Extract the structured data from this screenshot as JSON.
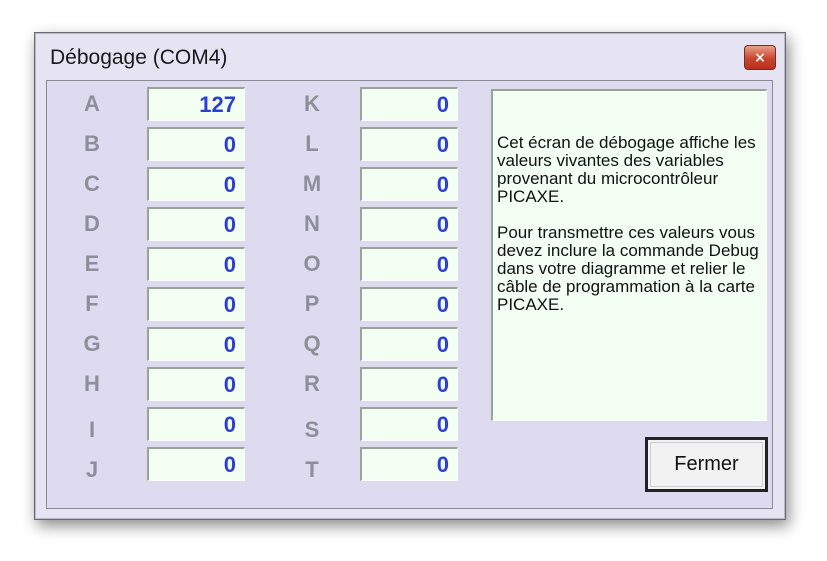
{
  "window": {
    "title": "Débogage (COM4)",
    "close_label": "×"
  },
  "variables": {
    "left": [
      {
        "name": "A",
        "value": "127"
      },
      {
        "name": "B",
        "value": "0"
      },
      {
        "name": "C",
        "value": "0"
      },
      {
        "name": "D",
        "value": "0"
      },
      {
        "name": "E",
        "value": "0"
      },
      {
        "name": "F",
        "value": "0"
      },
      {
        "name": "G",
        "value": "0"
      },
      {
        "name": "H",
        "value": "0"
      },
      {
        "name": "I",
        "value": "0"
      },
      {
        "name": "J",
        "value": "0"
      }
    ],
    "right": [
      {
        "name": "K",
        "value": "0"
      },
      {
        "name": "L",
        "value": "0"
      },
      {
        "name": "M",
        "value": "0"
      },
      {
        "name": "N",
        "value": "0"
      },
      {
        "name": "O",
        "value": "0"
      },
      {
        "name": "P",
        "value": "0"
      },
      {
        "name": "Q",
        "value": "0"
      },
      {
        "name": "R",
        "value": "0"
      },
      {
        "name": "S",
        "value": "0"
      },
      {
        "name": "T",
        "value": "0"
      }
    ]
  },
  "info": {
    "paragraph1": "Cet écran de débogage affiche les valeurs vivantes des variables provenant du microcontrôleur PICAXE.",
    "paragraph2": "Pour transmettre ces valeurs vous devez inclure la commande Debug dans votre diagramme et relier le câble de programmation à la carte PICAXE."
  },
  "buttons": {
    "close_label": "Fermer"
  },
  "colors": {
    "value_text": "#2b3fd6",
    "label_text": "#8e8e98",
    "field_background": "#f2fff2",
    "window_background": "#e6e4f2",
    "close_button": "#c9452f"
  }
}
